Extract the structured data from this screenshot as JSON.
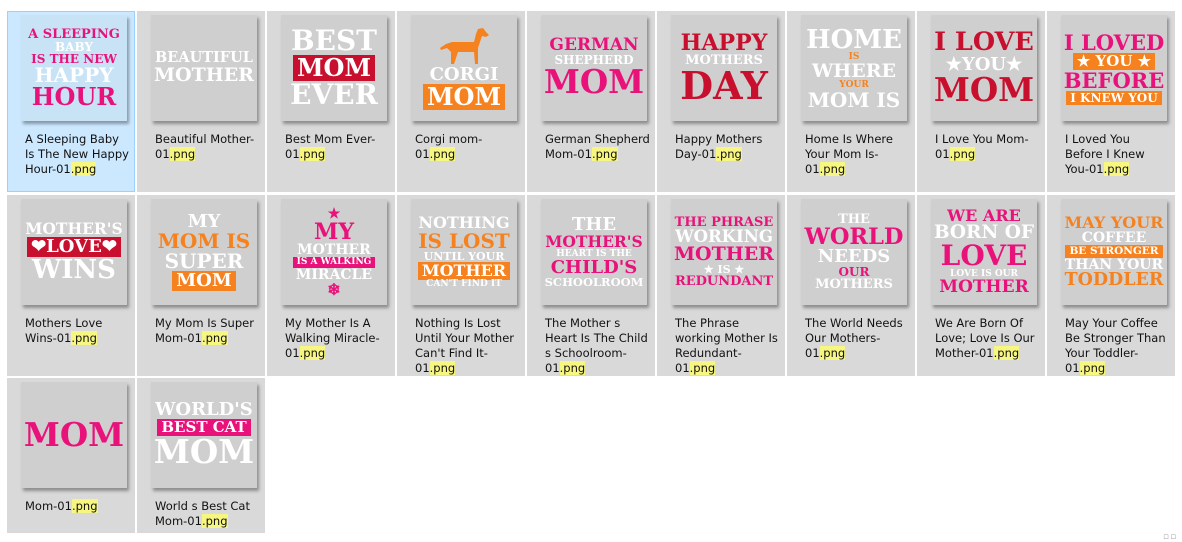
{
  "files": [
    {
      "base": "A Sleeping Baby Is The New Happy Hour-01",
      "ext": ".png",
      "selected": true,
      "bg": "#c8e3f6",
      "art": [
        {
          "t": "A SLEEPING",
          "c": "#e8127a",
          "s": 13
        },
        {
          "t": "BABY",
          "c": "#ffffff",
          "s": 12
        },
        {
          "t": "IS THE NEW",
          "c": "#e8127a",
          "s": 12
        },
        {
          "t": "HAPPY",
          "c": "#ffffff",
          "s": 20
        },
        {
          "t": "HOUR",
          "c": "#e8127a",
          "s": 24
        }
      ]
    },
    {
      "base": "Beautiful Mother-01",
      "ext": ".png",
      "art": [
        {
          "t": "BEAUTIFUL",
          "c": "#ffffff",
          "s": 15
        },
        {
          "t": "MOTHER",
          "c": "#ffffff",
          "s": 20
        }
      ]
    },
    {
      "base": "Best Mom Ever-01",
      "ext": ".png",
      "art": [
        {
          "t": "BEST",
          "c": "#ffffff",
          "s": 28
        },
        {
          "t": "MOM",
          "c": "#ffffff",
          "bg": "#c8102e",
          "s": 24
        },
        {
          "t": "EVER",
          "c": "#ffffff",
          "s": 28
        }
      ]
    },
    {
      "base": "Corgi mom-01",
      "ext": ".png",
      "dog": true,
      "art": [
        {
          "t": "CORGI",
          "c": "#ffffff",
          "s": 18
        },
        {
          "t": "MOM",
          "c": "#ffffff",
          "bg": "#f5821f",
          "s": 24
        }
      ]
    },
    {
      "base": "German Shepherd Mom-01",
      "ext": ".png",
      "art": [
        {
          "t": "GERMAN",
          "c": "#e8127a",
          "s": 17
        },
        {
          "t": "SHEPHERD",
          "c": "#ffffff",
          "s": 12
        },
        {
          "t": "MOM",
          "c": "#e8127a",
          "s": 34
        }
      ]
    },
    {
      "base": "Happy Mothers Day-01",
      "ext": ".png",
      "art": [
        {
          "t": "HAPPY",
          "c": "#c8102e",
          "s": 22
        },
        {
          "t": "MOTHERS",
          "c": "#ffffff",
          "s": 13
        },
        {
          "t": "DAY",
          "c": "#c8102e",
          "s": 38
        }
      ]
    },
    {
      "base": "Home Is Where Your Mom Is-01",
      "ext": ".png",
      "art": [
        {
          "t": "HOME",
          "c": "#ffffff",
          "s": 26
        },
        {
          "t": "IS",
          "c": "#f5821f",
          "s": 9
        },
        {
          "t": "WHERE",
          "c": "#ffffff",
          "s": 19
        },
        {
          "t": "YOUR",
          "c": "#f5821f",
          "s": 9
        },
        {
          "t": "MOM IS",
          "c": "#ffffff",
          "s": 20
        }
      ]
    },
    {
      "base": "I Love You Mom-01",
      "ext": ".png",
      "art": [
        {
          "t": "I LOVE",
          "c": "#c8102e",
          "s": 26
        },
        {
          "t": "★YOU★",
          "c": "#ffffff",
          "s": 18
        },
        {
          "t": "MOM",
          "c": "#c8102e",
          "s": 34
        }
      ]
    },
    {
      "base": "I Loved You Before I Knew You-01",
      "ext": ".png",
      "art": [
        {
          "t": "I LOVED",
          "c": "#e8127a",
          "s": 21
        },
        {
          "t": "★ YOU ★",
          "c": "#ffffff",
          "bg": "#f5821f",
          "s": 15
        },
        {
          "t": "BEFORE",
          "c": "#e8127a",
          "s": 21
        },
        {
          "t": "I KNEW YOU",
          "c": "#ffffff",
          "bg": "#f5821f",
          "s": 12
        }
      ]
    },
    {
      "base": "Mothers Love Wins-01",
      "ext": ".png",
      "art": [
        {
          "t": "MOTHER'S",
          "c": "#ffffff",
          "s": 16
        },
        {
          "t": "❤LOVE❤",
          "c": "#ffffff",
          "bg": "#c8102e",
          "s": 18
        },
        {
          "t": "WINS",
          "c": "#ffffff",
          "s": 26
        }
      ]
    },
    {
      "base": "My Mom Is Super Mom-01",
      "ext": ".png",
      "art": [
        {
          "t": "MY",
          "c": "#ffffff",
          "s": 18
        },
        {
          "t": "MOM IS",
          "c": "#f5821f",
          "s": 20
        },
        {
          "t": "SUPER",
          "c": "#ffffff",
          "s": 20
        },
        {
          "t": "MOM",
          "c": "#ffffff",
          "bg": "#f5821f",
          "s": 18
        }
      ]
    },
    {
      "base": "My Mother Is A Walking Miracle-01",
      "ext": ".png",
      "art": [
        {
          "t": "★",
          "c": "#e8127a",
          "s": 14
        },
        {
          "t": "MY",
          "c": "#e8127a",
          "s": 22
        },
        {
          "t": "MOTHER",
          "c": "#ffffff",
          "s": 14
        },
        {
          "t": "IS A WALKING",
          "c": "#ffffff",
          "bg": "#e8127a",
          "s": 9
        },
        {
          "t": "MIRACLE",
          "c": "#ffffff",
          "s": 14
        },
        {
          "t": "❄",
          "c": "#e8127a",
          "s": 16
        }
      ]
    },
    {
      "base": "Nothing Is Lost Until Your Mother Can't Find It-01",
      "ext": ".png",
      "art": [
        {
          "t": "NOTHING",
          "c": "#ffffff",
          "s": 16
        },
        {
          "t": "IS LOST",
          "c": "#f5821f",
          "s": 20
        },
        {
          "t": "UNTIL YOUR",
          "c": "#ffffff",
          "s": 11
        },
        {
          "t": "MOTHER",
          "c": "#ffffff",
          "bg": "#f5821f",
          "s": 16
        },
        {
          "t": "CAN'T FIND IT",
          "c": "#ffffff",
          "s": 9
        }
      ]
    },
    {
      "base": "The Mother s Heart Is The Child s Schoolroom-01",
      "ext": ".png",
      "art": [
        {
          "t": "THE",
          "c": "#ffffff",
          "s": 18
        },
        {
          "t": "MOTHER'S",
          "c": "#e8127a",
          "s": 20
        },
        {
          "t": "HEART IS THE",
          "c": "#ffffff",
          "s": 9
        },
        {
          "t": "CHILD'S",
          "c": "#e8127a",
          "s": 18
        },
        {
          "t": "SCHOOLROOM",
          "c": "#ffffff",
          "s": 12
        }
      ]
    },
    {
      "base": "The Phrase working Mother Is Redundant-01",
      "ext": ".png",
      "art": [
        {
          "t": "THE PHRASE",
          "c": "#e8127a",
          "s": 13
        },
        {
          "t": "WORKING",
          "c": "#ffffff",
          "s": 17
        },
        {
          "t": "MOTHER",
          "c": "#e8127a",
          "s": 22
        },
        {
          "t": "★ IS ★",
          "c": "#ffffff",
          "s": 11
        },
        {
          "t": "REDUNDANT",
          "c": "#e8127a",
          "s": 15
        }
      ]
    },
    {
      "base": "The World Needs Our Mothers-01",
      "ext": ".png",
      "art": [
        {
          "t": "THE",
          "c": "#ffffff",
          "s": 13
        },
        {
          "t": "WORLD",
          "c": "#e8127a",
          "s": 24
        },
        {
          "t": "NEEDS",
          "c": "#ffffff",
          "s": 18
        },
        {
          "t": "OUR",
          "c": "#e8127a",
          "s": 12
        },
        {
          "t": "MOTHERS",
          "c": "#ffffff",
          "s": 13
        }
      ]
    },
    {
      "base": "We Are Born Of Love; Love Is Our Mother-01",
      "ext": ".png",
      "art": [
        {
          "t": "WE ARE",
          "c": "#e8127a",
          "s": 16
        },
        {
          "t": "BORN OF",
          "c": "#ffffff",
          "s": 19
        },
        {
          "t": "LOVE",
          "c": "#e8127a",
          "s": 28
        },
        {
          "t": "LOVE IS OUR",
          "c": "#ffffff",
          "s": 9
        },
        {
          "t": "MOTHER",
          "c": "#e8127a",
          "s": 17
        }
      ]
    },
    {
      "base": "May Your Coffee Be Stronger Than Your Toddler-01",
      "ext": ".png",
      "art": [
        {
          "t": "MAY YOUR",
          "c": "#f5821f",
          "s": 16
        },
        {
          "t": "COFFEE",
          "c": "#ffffff",
          "s": 14
        },
        {
          "t": "BE STRONGER",
          "c": "#ffffff",
          "bg": "#f5821f",
          "s": 11
        },
        {
          "t": "THAN YOUR",
          "c": "#ffffff",
          "s": 14
        },
        {
          "t": "TODDLER",
          "c": "#f5821f",
          "s": 20
        }
      ]
    },
    {
      "base": "Mom-01",
      "ext": ".png",
      "art": [
        {
          "t": "MOM",
          "c": "#e8127a",
          "s": 40
        }
      ]
    },
    {
      "base": "World s Best Cat Mom-01",
      "ext": ".png",
      "art": [
        {
          "t": "WORLD'S",
          "c": "#ffffff",
          "s": 18
        },
        {
          "t": "BEST CAT",
          "c": "#ffffff",
          "bg": "#e8127a",
          "s": 15
        },
        {
          "t": "MOM",
          "c": "#ffffff",
          "s": 36
        }
      ]
    }
  ],
  "corner_glyph": "☐ ☐"
}
